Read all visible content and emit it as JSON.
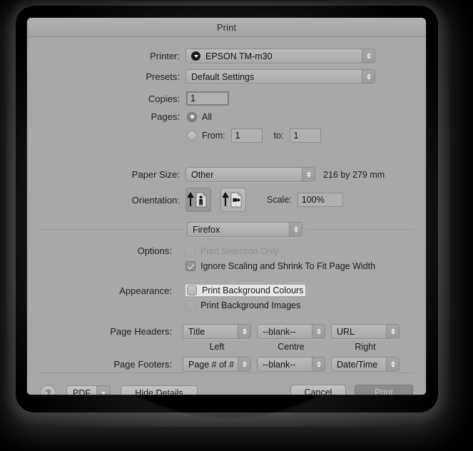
{
  "window": {
    "title": "Print"
  },
  "printer": {
    "label": "Printer:",
    "value": "EPSON TM-m30",
    "icon": "printer-status-icon"
  },
  "presets": {
    "label": "Presets:",
    "value": "Default Settings"
  },
  "copies": {
    "label": "Copies:",
    "value": "1"
  },
  "pages": {
    "label": "Pages:",
    "all_label": "All",
    "all_selected": true,
    "from_label": "From:",
    "from_value": "1",
    "to_label": "to:",
    "to_value": "1"
  },
  "paper_size": {
    "label": "Paper Size:",
    "value": "Other",
    "dimensions": "216 by 279 mm"
  },
  "orientation": {
    "label": "Orientation:",
    "portrait_name": "portrait-orientation",
    "landscape_name": "landscape-orientation",
    "selected": "portrait"
  },
  "scale": {
    "label": "Scale:",
    "value": "100%"
  },
  "app_panel": {
    "value": "Firefox"
  },
  "options": {
    "label": "Options:",
    "items": [
      {
        "label": "Print Selection Only",
        "checked": false,
        "disabled": true
      },
      {
        "label": "Ignore Scaling and Shrink To Fit Page Width",
        "checked": true,
        "disabled": false
      }
    ]
  },
  "appearance": {
    "label": "Appearance:",
    "items": [
      {
        "label": "Print Background Colours",
        "checked": false,
        "highlighted": true
      },
      {
        "label": "Print Background Images",
        "checked": false,
        "highlighted": false
      }
    ]
  },
  "page_headers": {
    "label": "Page Headers:",
    "left": "Title",
    "centre": "--blank--",
    "right": "URL"
  },
  "column_labels": {
    "left": "Left",
    "centre": "Centre",
    "right": "Right"
  },
  "page_footers": {
    "label": "Page Footers:",
    "left": "Page # of #",
    "centre": "--blank--",
    "right": "Date/Time"
  },
  "footer_buttons": {
    "help": "?",
    "pdf": "PDF",
    "hide_details": "Hide Details",
    "cancel": "Cancel",
    "print": "Print"
  }
}
